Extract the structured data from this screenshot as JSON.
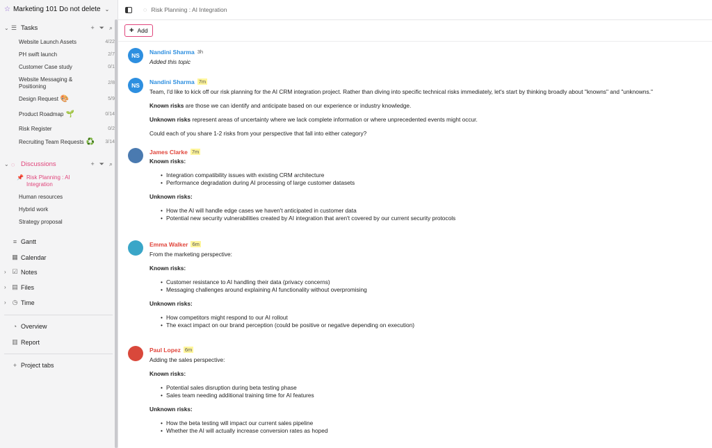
{
  "workspace": {
    "title": "Marketing 101 Do not delete"
  },
  "sidebar": {
    "tasks": {
      "label": "Tasks",
      "items": [
        {
          "label": "Website Launch Assets",
          "count": "4/22",
          "emoji": ""
        },
        {
          "label": "PH swift launch",
          "count": "2/7",
          "emoji": ""
        },
        {
          "label": "Customer Case study",
          "count": "0/1",
          "emoji": ""
        },
        {
          "label": "Website Messaging & Positioning",
          "count": "2/8",
          "emoji": ""
        },
        {
          "label": "Design Request",
          "count": "5/9",
          "emoji": "🎨"
        },
        {
          "label": "Product Roadmap",
          "count": "0/14",
          "emoji": "🌱"
        },
        {
          "label": "Risk Register",
          "count": "0/2",
          "emoji": ""
        },
        {
          "label": "Recruiting Team Requests",
          "count": "3/14",
          "emoji": "♻️"
        }
      ]
    },
    "discussions": {
      "label": "Discussions",
      "items": [
        {
          "label": "Risk Planning : AI Integration"
        },
        {
          "label": "Human resources"
        },
        {
          "label": "Hybrid work"
        },
        {
          "label": "Strategy proposal"
        }
      ]
    },
    "nav": {
      "gantt": "Gantt",
      "calendar": "Calendar",
      "notes": "Notes",
      "files": "Files",
      "time": "Time",
      "overview": "Overview",
      "report": "Report",
      "project_tabs": "Project tabs"
    }
  },
  "header": {
    "breadcrumb": "Risk Planning : AI Integration"
  },
  "toolbar": {
    "add_label": "Add"
  },
  "accent_color": "#e0457b",
  "posts": [
    {
      "initials": "NS",
      "author": "Nandini Sharma",
      "time": "3h",
      "text": "Added this topic"
    },
    {
      "initials": "NS",
      "author": "Nandini Sharma",
      "time": "7m",
      "p1": "Team, I'd like to kick off our risk planning for the AI CRM integration project. Rather than diving into specific technical risks immediately, let's start by thinking broadly about \"knowns\" and \"unknowns.\"",
      "p2_bold": "Known risks",
      "p2": " are those we can identify and anticipate based on our experience or industry knowledge.",
      "p3_bold": "Unknown risks",
      "p3": " represent areas of uncertainty where we lack complete information or where unprecedented events might occur.",
      "p4": "Could each of you share 1-2 risks from your perspective that fall into either category?"
    },
    {
      "author": "James Clarke",
      "time": "7m",
      "known_label": "Known risks:",
      "known": [
        "Integration compatibility issues with existing CRM architecture",
        "Performance degradation during AI processing of large customer datasets"
      ],
      "unknown_label": "Unknown risks:",
      "unknown": [
        "How the AI will handle edge cases we haven't anticipated in customer data",
        "Potential new security vulnerabilities created by AI integration that aren't covered by our current security protocols"
      ]
    },
    {
      "author": "Emma Walker",
      "time": "6m",
      "intro": "From the marketing perspective:",
      "known_label": "Known risks:",
      "known": [
        "Customer resistance to AI handling their data (privacy concerns)",
        "Messaging challenges around explaining AI functionality without overpromising"
      ],
      "unknown_label": "Unknown risks:",
      "unknown": [
        "How competitors might respond to our AI rollout",
        "The exact impact on our brand perception (could be positive or negative depending on execution)"
      ]
    },
    {
      "author": "Paul Lopez",
      "time": "6m",
      "intro": "Adding the sales perspective:",
      "known_label": "Known risks:",
      "known": [
        "Potential sales disruption during beta testing phase",
        "Sales team needing additional training time for AI features"
      ],
      "unknown_label": "Unknown risks:",
      "unknown": [
        "How the beta testing will impact our current sales pipeline",
        "Whether the AI will actually increase conversion rates as hoped"
      ]
    }
  ]
}
